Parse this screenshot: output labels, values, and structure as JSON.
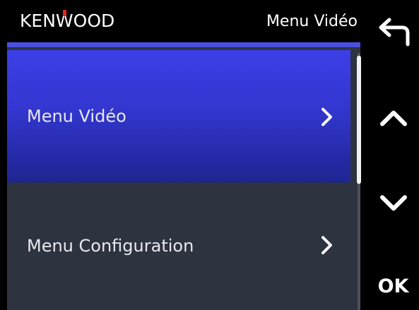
{
  "header": {
    "brand": "KENWOOD",
    "title": "Menu Vidéo"
  },
  "menu": {
    "items": [
      {
        "label": "Menu Vidéo",
        "selected": true,
        "chevron": "chevron-right-icon"
      },
      {
        "label": "Menu Configuration",
        "selected": false,
        "chevron": "chevron-right-icon"
      }
    ]
  },
  "side_buttons": {
    "back": "back-arrow-icon",
    "up": "chevron-up-icon",
    "down": "chevron-down-icon",
    "ok_label": "OK"
  },
  "scroll": {
    "position_fraction": 0.0,
    "visible_fraction": 0.5
  },
  "colors": {
    "accent": "#4a4fe0",
    "selected_top": "#3c3fe6",
    "selected_bottom": "#1e2690",
    "item_bg": "#2e3340",
    "brand_dot": "#e3261f"
  }
}
